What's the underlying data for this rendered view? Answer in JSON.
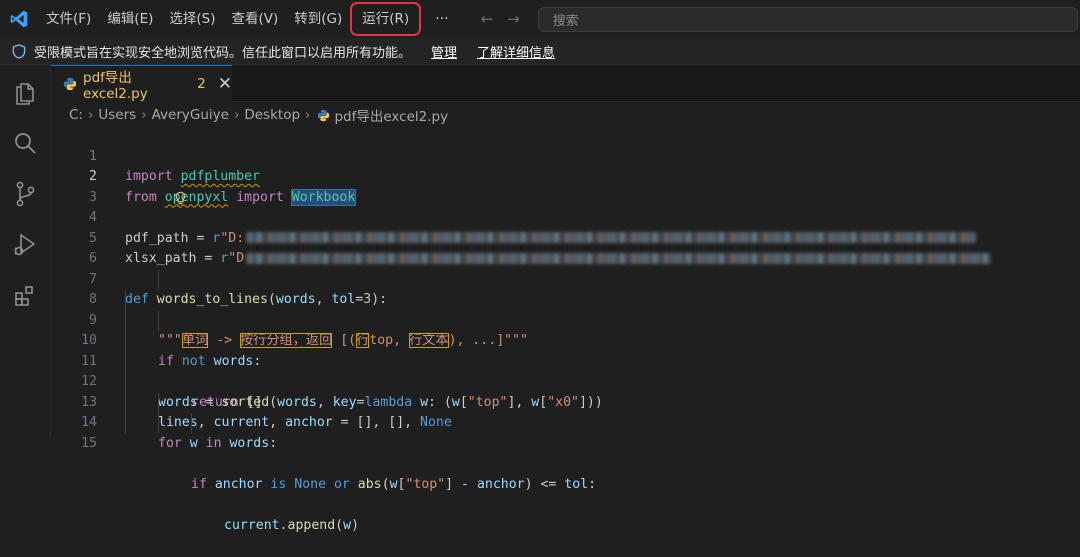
{
  "menu": {
    "items": [
      "文件(F)",
      "编辑(E)",
      "选择(S)",
      "查看(V)",
      "转到(G)"
    ],
    "run": "运行(R)",
    "more": "···"
  },
  "search": {
    "placeholder": "搜索"
  },
  "banner": {
    "message": "受限模式旨在实现安全地浏览代码。信任此窗口以启用所有功能。",
    "manage": "管理",
    "learn_more": "了解详细信息"
  },
  "tab": {
    "filename": "pdf导出excel2.py",
    "problems": "2"
  },
  "breadcrumb": {
    "parts": [
      "C:",
      "Users",
      "AveryGuiye",
      "Desktop"
    ],
    "file": "pdf导出excel2.py"
  },
  "code": {
    "line_numbers": [
      "1",
      "2",
      "3",
      "4",
      "5",
      "6",
      "7",
      "8",
      "9",
      "10",
      "11",
      "12",
      "13",
      "14",
      "15"
    ],
    "l1": {
      "kw": "import",
      "mod": "pdfplumber"
    },
    "l2": {
      "kw1": "from",
      "mod": "openpyxl",
      "kw2": "import",
      "cls": "Workbook"
    },
    "l4": {
      "var": "pdf_path",
      "eq": " = ",
      "prefix": "r",
      "str": "\"D:"
    },
    "l5": {
      "var": "xlsx_path",
      "eq": " = ",
      "prefix": "r",
      "str": "\"D"
    },
    "l7": {
      "kw": "def",
      "fn": "words_to_lines",
      "p1": "(",
      "a1": "words",
      "c": ", ",
      "a2": "tol",
      "eq": "=",
      "n": "3",
      "p2": "):"
    },
    "l8": {
      "q": "\"\"\"",
      "t1": "单词",
      "t2": " -> ",
      "t3": "按行分组，返回",
      "t4": " [(",
      "t5": "行",
      "t6": "top, ",
      "t7": "行文本",
      "t8": "), ...]",
      "q2": "\"\"\""
    },
    "l9": {
      "kw": "if",
      "kw2": "not",
      "var": "words",
      "p": ":"
    },
    "l10": {
      "kw": "return",
      "p": " []"
    },
    "l11": {
      "var": "words",
      "eq": " = ",
      "fn": "sorted",
      "rest1": "(",
      "v2": "words",
      "rest2": ", ",
      "v3": "key",
      "rest3": "=",
      "kw": "lambda",
      "v4": " w",
      "rest4": ": (",
      "v5": "w",
      "rest5": "[",
      "s1": "\"top\"",
      "rest6": "], ",
      "v6": "w",
      "rest7": "[",
      "s2": "\"x0\"",
      "rest8": "]))"
    },
    "l12": {
      "v1": "lines",
      "c1": ", ",
      "v2": "current",
      "c2": ", ",
      "v3": "anchor",
      "eq": " = [], [], ",
      "kw": "None"
    },
    "l13": {
      "kw": "for",
      "v": " w ",
      "kw2": "in",
      "v2": " words",
      "p": ":"
    },
    "l14": {
      "kw": "if",
      "v": " anchor ",
      "kw2": "is",
      "kw3": " None ",
      "kw4": "or",
      "fn": " abs",
      "p1": "(",
      "v2": "w",
      "p2": "[",
      "s": "\"top\"",
      "p3": "] - ",
      "v3": "anchor",
      "p4": ") <= ",
      "v4": "tol",
      "p5": ":"
    },
    "l15": {
      "v": "current",
      "p": ".",
      "fn": "append",
      "p2": "(",
      "v2": "w",
      "p3": ")"
    }
  },
  "colors": {
    "accent": "#0078d4",
    "highlight": "#e0363f",
    "warning": "#c99a00"
  }
}
